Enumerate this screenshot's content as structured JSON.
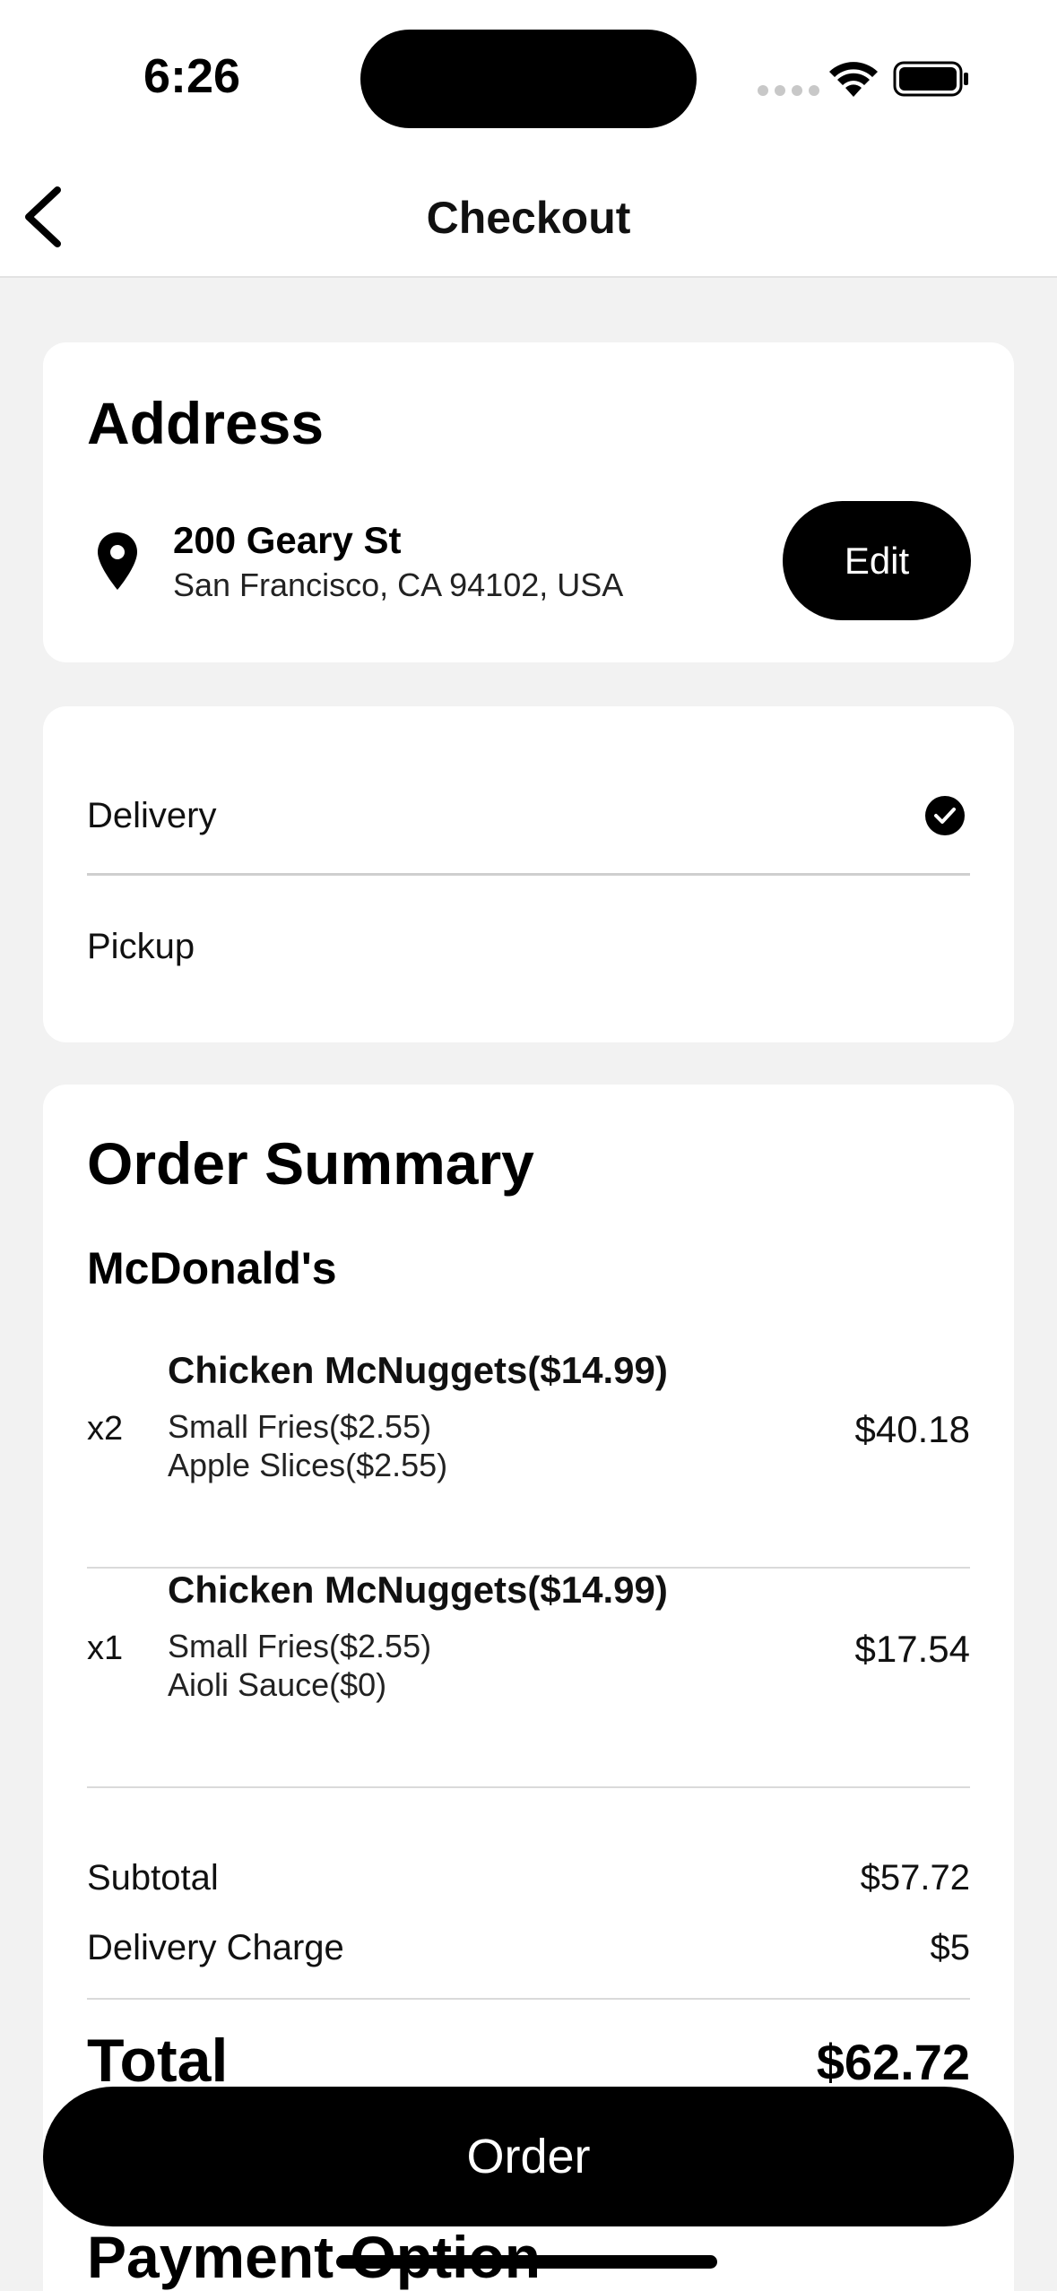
{
  "status_bar": {
    "time": "6:26",
    "icons": [
      "signal-icon",
      "wifi-icon",
      "battery-icon"
    ]
  },
  "nav": {
    "title": "Checkout",
    "back_icon": "chevron-left-icon"
  },
  "address": {
    "heading": "Address",
    "line1": "200 Geary St",
    "line2": "San Francisco, CA 94102, USA",
    "edit_label": "Edit",
    "icon": "location-pin-icon"
  },
  "fulfillment": {
    "options": [
      {
        "label": "Delivery",
        "selected": true
      },
      {
        "label": "Pickup",
        "selected": false
      }
    ]
  },
  "order_summary": {
    "heading": "Order Summary",
    "restaurant": "McDonald's",
    "items": [
      {
        "qty": "x2",
        "name": "Chicken McNuggets($14.99)",
        "options": [
          "Small Fries($2.55)",
          "Apple Slices($2.55)"
        ],
        "price": "$40.18"
      },
      {
        "qty": "x1",
        "name": "Chicken McNuggets($14.99)",
        "options": [
          "Small Fries($2.55)",
          "Aioli Sauce($0)"
        ],
        "price": "$17.54"
      }
    ],
    "subtotal_label": "Subtotal",
    "subtotal_value": "$57.72",
    "delivery_label": "Delivery Charge",
    "delivery_value": "$5",
    "total_label": "Total",
    "total_value": "$62.72"
  },
  "payment": {
    "heading": "Payment Option"
  },
  "order_button": {
    "label": "Order"
  },
  "colors": {
    "background": "#f2f2f2",
    "card": "#ffffff",
    "primary": "#000000",
    "on_primary": "#ffffff",
    "divider": "#dadada"
  }
}
